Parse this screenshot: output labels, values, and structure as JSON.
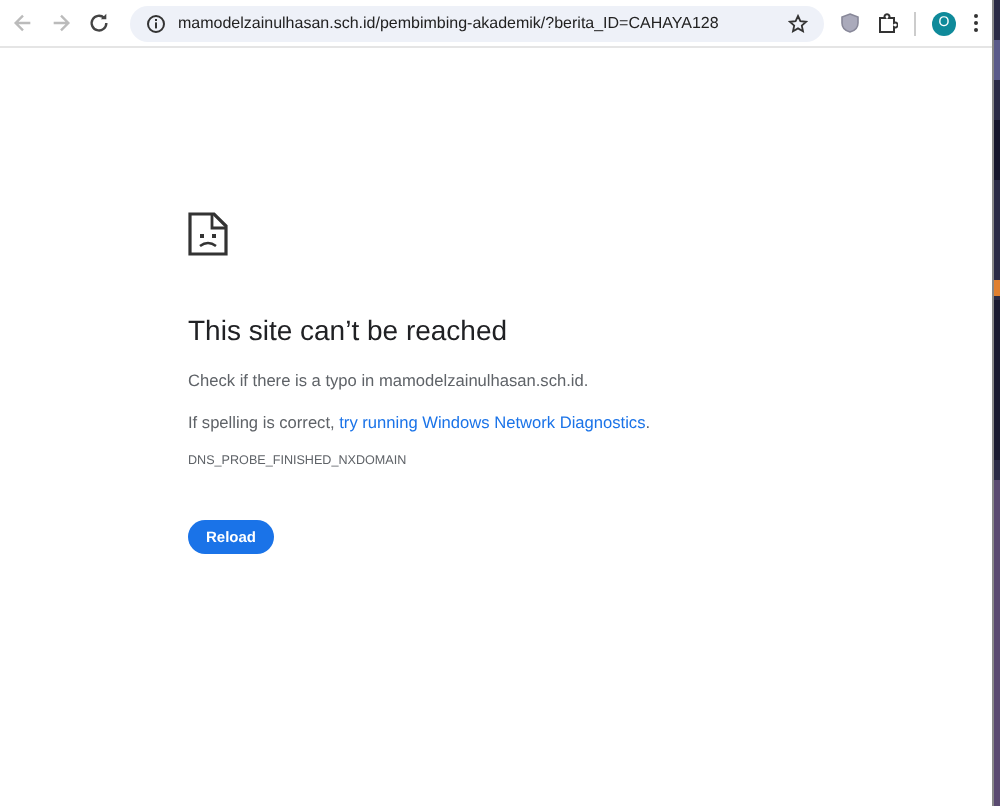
{
  "toolbar": {
    "url": "mamodelzainulhasan.sch.id/pembimbing-akademik/?berita_ID=CAHAYA128",
    "back_disabled": true,
    "forward_disabled": true,
    "profile_letter": "O"
  },
  "error": {
    "title": "This site can’t be reached",
    "message": "Check if there is a typo in mamodelzainulhasan.sch.id.",
    "suggestion_prefix": "If spelling is correct, ",
    "suggestion_link": "try running Windows Network Diagnostics",
    "suggestion_suffix": ".",
    "code": "DNS_PROBE_FINISHED_NXDOMAIN",
    "button": "Reload"
  }
}
